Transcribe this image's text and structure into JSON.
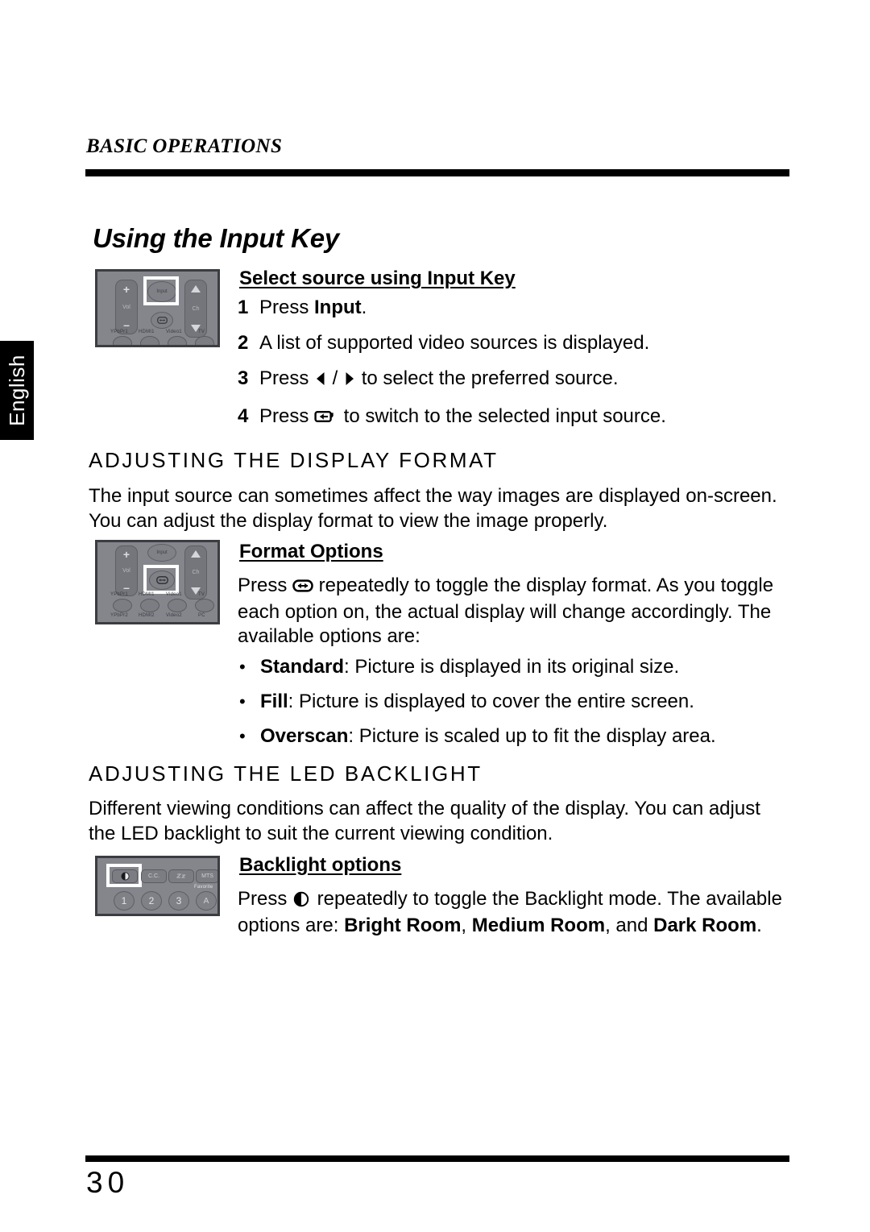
{
  "page": {
    "running_head": "BASIC OPERATIONS",
    "language_tab": "English",
    "page_number": "30",
    "title": "Using the Input Key"
  },
  "input_key_section": {
    "sub_head": "Select source using Input Key",
    "steps": [
      {
        "num": "1",
        "before": "Press ",
        "bold": "Input",
        "after": "."
      },
      {
        "num": "2",
        "before": "A list of supported video sources is displayed.",
        "bold": "",
        "after": ""
      },
      {
        "num": "3",
        "before": "Press ",
        "bold": "",
        "after": " to select the preferred source.",
        "icon": "left-right-triangle-keys"
      },
      {
        "num": "4",
        "before": "Press ",
        "bold": "",
        "after": " to switch to the selected input source.",
        "icon": "input-enter-key"
      }
    ]
  },
  "display_format_section": {
    "heading": "ADJUSTING THE DISPLAY FORMAT",
    "paragraph": "The input source can sometimes affect the way images are displayed on-screen. You can adjust the display format to view the image properly.",
    "sub_head": "Format Options",
    "press_before": "Press ",
    "press_icon": "format-toggle-key",
    "press_after": " repeatedly to toggle the display format. As you toggle each option on, the actual display will change accordingly. The available options are:",
    "bullets": [
      {
        "bullet": "•",
        "term": "Standard",
        "desc": ": Picture is displayed in its original size."
      },
      {
        "bullet": "•",
        "term": "Fill",
        "desc": ": Picture is displayed to cover the entire screen."
      },
      {
        "bullet": "•",
        "term": "Overscan",
        "desc": ": Picture is scaled up to fit the display area."
      }
    ]
  },
  "backlight_section": {
    "heading": "ADJUSTING THE LED BACKLIGHT",
    "paragraph": "Different viewing conditions can affect the quality of the display. You can adjust the LED backlight to suit the current viewing condition.",
    "sub_head": "Backlight options",
    "press_before": "Press ",
    "press_icon": "backlight-contrast-key",
    "press_after_1": " repeatedly to toggle the Backlight mode. The available options are: ",
    "option_1": "Bright Room",
    "sep_1": ", ",
    "option_2": "Medium Room",
    "sep_2": ", and ",
    "option_3": "Dark Room",
    "end": "."
  },
  "remote_figures": [
    {
      "name": "remote-input-key",
      "highlighted_button": "Input",
      "buttons": {
        "volume_up": "+",
        "volume_label": "Vol",
        "volume_down": "–",
        "input": "Input",
        "channel_label": "Ch"
      },
      "source_labels_row1": [
        "YPbPr1",
        "HDMI1",
        "Video1",
        "TV"
      ]
    },
    {
      "name": "remote-format-key",
      "highlighted_button": "Format",
      "buttons": {
        "volume_up": "+",
        "volume_label": "Vol",
        "volume_down": "–",
        "input": "Input",
        "channel_label": "Ch"
      },
      "source_labels_row1": [
        "YPbPr1",
        "HDMI1",
        "Video1",
        "TV"
      ],
      "source_labels_row2": [
        "YPbPr2",
        "HDMI2",
        "Video2",
        "PC"
      ]
    },
    {
      "name": "remote-backlight-key",
      "highlighted_button": "Backlight",
      "top_row": [
        "Backlight",
        "C.C.",
        "Sleep",
        "MTS"
      ],
      "number_row": [
        "1",
        "2",
        "3",
        "A"
      ],
      "favorite_label": "Favorite"
    }
  ],
  "colors": {
    "page_background": "#ffffff",
    "text": "#000000",
    "rule": "#000000",
    "tab_background": "#000000",
    "tab_text": "#ffffff",
    "remote_body": "#84868c",
    "remote_frame": "#3c3d41",
    "highlight_box": "#ffffff"
  }
}
